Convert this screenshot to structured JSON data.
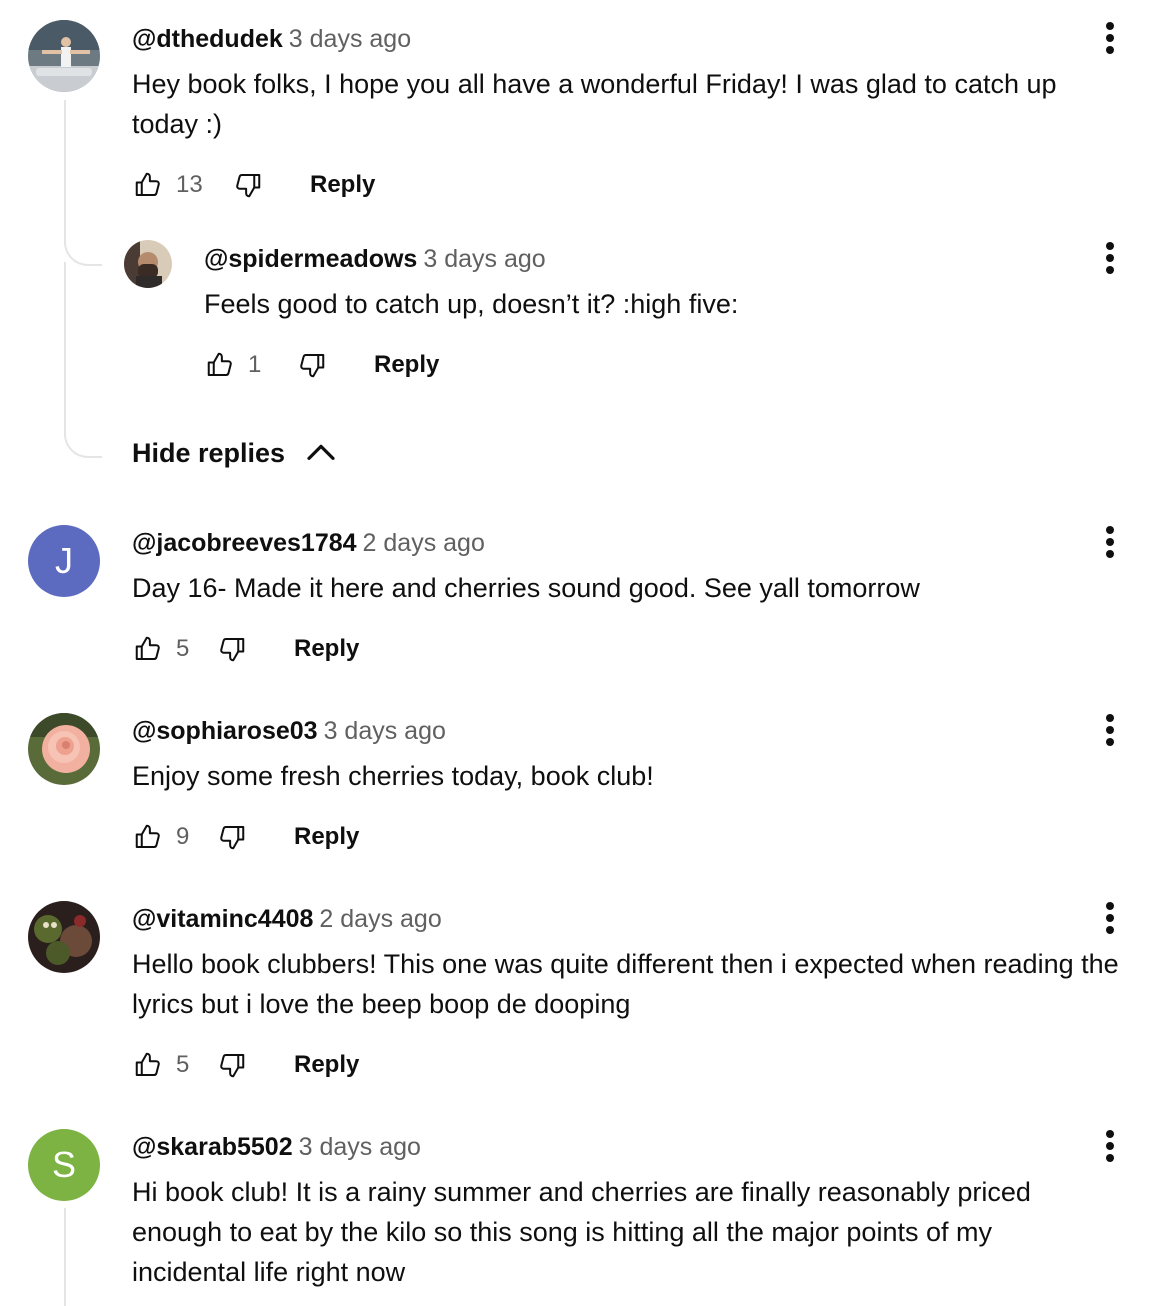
{
  "comments": [
    {
      "handle": "@dthedudek",
      "time": "3 days ago",
      "text": "Hey book folks, I hope you all have a wonderful Friday! I was glad to catch up today :)",
      "likes": "13",
      "reply_label": "Reply"
    },
    {
      "handle": "@spidermeadows",
      "time": "3 days ago",
      "text": "Feels good to catch up, doesn’t it? :high five:",
      "likes": "1",
      "reply_label": "Reply"
    },
    {
      "handle": "@jacobreeves1784",
      "time": "2 days ago",
      "text": "Day 16- Made it here and cherries sound good. See yall tomorrow",
      "likes": "5",
      "reply_label": "Reply",
      "avatar_letter": "J",
      "avatar_color": "#5c6bc0"
    },
    {
      "handle": "@sophiarose03",
      "time": "3 days ago",
      "text": "Enjoy some fresh cherries today, book club!",
      "likes": "9",
      "reply_label": "Reply"
    },
    {
      "handle": "@vitaminc4408",
      "time": "2 days ago",
      "text": "Hello book clubbers! This one was quite different then i expected when reading the lyrics but i love the beep boop de dooping",
      "likes": "5",
      "reply_label": "Reply"
    },
    {
      "handle": "@skarab5502",
      "time": "3 days ago",
      "text": "Hi book club! It is a rainy summer and cherries are finally reasonably priced enough to eat by the kilo so this song is hitting all the major points of my incidental life right now",
      "avatar_letter": "S",
      "avatar_color": "#7cb342"
    }
  ],
  "hide_replies_label": "Hide replies",
  "icons": {
    "like": "thumbs-up-icon",
    "dislike": "thumbs-down-icon",
    "menu": "more-vert-icon",
    "collapse": "chevron-up-icon"
  }
}
